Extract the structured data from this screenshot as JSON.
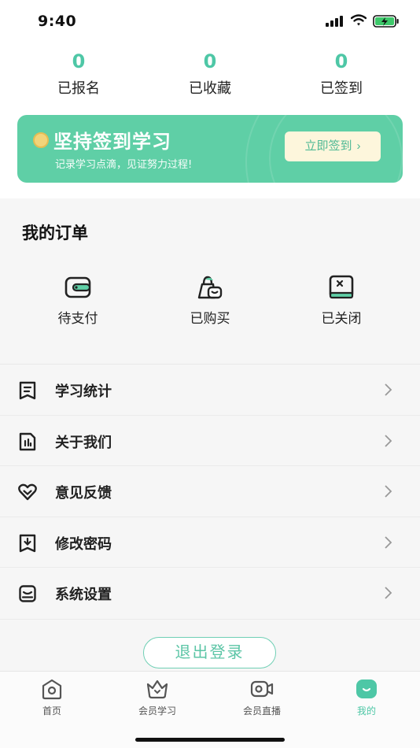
{
  "status": {
    "time": "9:40"
  },
  "stats": [
    {
      "num": "0",
      "label": "已报名"
    },
    {
      "num": "0",
      "label": "已收藏"
    },
    {
      "num": "0",
      "label": "已签到"
    }
  ],
  "banner": {
    "title": "坚持签到学习",
    "subtitle": "记录学习点滴，见证努力过程!",
    "button_label": "立即签到",
    "button_chevron": "›",
    "bg_color": "#5fcfa6"
  },
  "orders": {
    "title": "我的订单",
    "items": [
      {
        "label": "待支付",
        "icon": "wallet-icon"
      },
      {
        "label": "已购买",
        "icon": "shopping-bag-icon"
      },
      {
        "label": "已关闭",
        "icon": "closed-order-icon"
      }
    ]
  },
  "menu": [
    {
      "label": "学习统计",
      "icon": "document-list-icon"
    },
    {
      "label": "关于我们",
      "icon": "info-chart-icon"
    },
    {
      "label": "意见反馈",
      "icon": "heart-feedback-icon"
    },
    {
      "label": "修改密码",
      "icon": "download-box-icon"
    },
    {
      "label": "系统设置",
      "icon": "settings-box-icon"
    }
  ],
  "logout": {
    "label": "退出登录"
  },
  "tabbar": [
    {
      "label": "首页",
      "icon": "home-icon",
      "active": false
    },
    {
      "label": "会员学习",
      "icon": "crown-icon",
      "active": false
    },
    {
      "label": "会员直播",
      "icon": "video-camera-icon",
      "active": false
    },
    {
      "label": "我的",
      "icon": "smile-face-icon",
      "active": true
    }
  ],
  "colors": {
    "accent": "#4ec7a6",
    "dark": "#222222"
  }
}
